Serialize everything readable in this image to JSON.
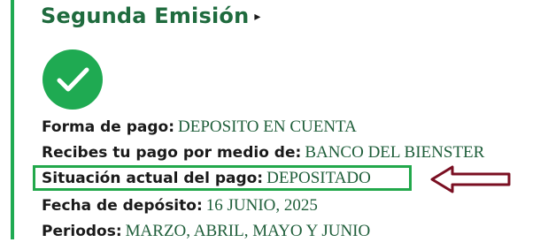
{
  "section": {
    "title": "Segunda Emisión",
    "title_marker": "▸"
  },
  "status_icon": "check-circle-icon",
  "details": [
    {
      "label": "Forma de pago:",
      "value": "DEPOSITO EN CUENTA"
    },
    {
      "label": "Recibes tu pago por medio de:",
      "value": "BANCO DEL BIENSTER"
    },
    {
      "label": "Situación actual del pago:",
      "value": "DEPOSITADO"
    },
    {
      "label": "Fecha de depósito:",
      "value": "16 JUNIO, 2025"
    },
    {
      "label": "Periodos:",
      "value": "MARZO, ABRIL, MAYO Y JUNIO"
    }
  ],
  "colors": {
    "accent_green": "#1faa52",
    "title_green": "#1f6b3e",
    "value_green": "#1f5e3a",
    "arrow_maroon": "#7a0f22"
  }
}
